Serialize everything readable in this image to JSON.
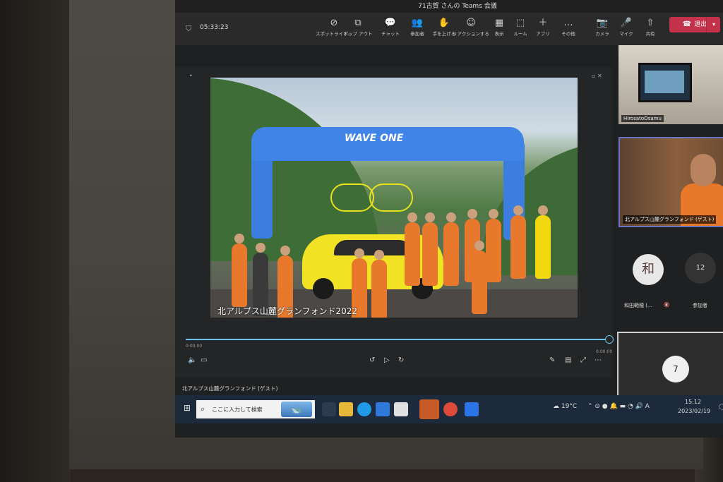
{
  "window": {
    "title": "71古賀 さんの Teams 会議"
  },
  "meeting": {
    "timer": "05:33:23"
  },
  "toolbar": [
    {
      "name": "spotlight",
      "icon": "spotlight-icon",
      "glyph": "⊘",
      "label": "スポットライト..."
    },
    {
      "name": "popout",
      "icon": "popout-icon",
      "glyph": "⧉",
      "label": "ポップ アウト"
    },
    {
      "name": "chat",
      "icon": "chat-icon",
      "glyph": "💬",
      "label": "チャット"
    },
    {
      "name": "participants",
      "icon": "people-icon",
      "glyph": "👥",
      "label": "参加者"
    },
    {
      "name": "raise-hand",
      "icon": "hand-icon",
      "glyph": "✋",
      "label": "手を上げる"
    },
    {
      "name": "reactions",
      "icon": "smile-icon",
      "glyph": "☺",
      "label": "リアクションする"
    },
    {
      "name": "view",
      "icon": "grid-icon",
      "glyph": "▦",
      "label": "表示"
    },
    {
      "name": "rooms",
      "icon": "rooms-icon",
      "glyph": "⬚",
      "label": "ルーム"
    },
    {
      "name": "apps",
      "icon": "plus-icon",
      "glyph": "＋",
      "label": "アプリ"
    },
    {
      "name": "more",
      "icon": "ellipsis-icon",
      "glyph": "…",
      "label": "その他"
    },
    {
      "name": "camera",
      "icon": "camera-off-icon",
      "glyph": "📷",
      "label": "カメラ"
    },
    {
      "name": "mic",
      "icon": "mic-icon",
      "glyph": "🎤",
      "label": "マイク"
    },
    {
      "name": "share",
      "icon": "share-icon",
      "glyph": "⇧",
      "label": "共有"
    }
  ],
  "leave": {
    "label": "退出",
    "icon": "phone-icon"
  },
  "video": {
    "caption": "北アルプス山麓グランフォンド2022",
    "arch_text": "WAVE ONE",
    "progress": 1.0,
    "time_start": "0:00:00",
    "time_end": "0:00:00"
  },
  "share_label": "北アルプス山麓グランフォンド (ゲスト)",
  "participants": {
    "room_name": "HirosatoOsamu",
    "guest_name": "北アルプス山麓グランフォンド (ゲスト)",
    "wada_initial": "和",
    "wada_label": "和田範穂 (...",
    "count": "12",
    "count_label": "参加者",
    "self_initial": "7"
  },
  "taskbar": {
    "search_placeholder": "ここに入力して検索",
    "temperature": "19°C",
    "ime": "A",
    "time": "15:12",
    "date": "2023/02/19"
  }
}
